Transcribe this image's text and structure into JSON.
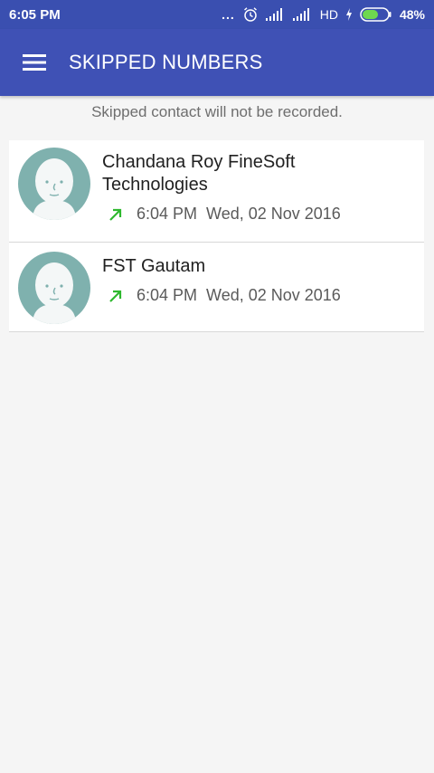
{
  "status_bar": {
    "time": "6:05 PM",
    "more": "...",
    "network": "HD",
    "battery": "48%"
  },
  "app_bar": {
    "title": "SKIPPED NUMBERS"
  },
  "hint": "Skipped contact will not be recorded.",
  "contacts": [
    {
      "name_line1": "Chandana Roy FineSoft",
      "name_line2": "Technologies",
      "time": "6:04 PM",
      "date": "Wed, 02 Nov 2016"
    },
    {
      "name_line1": "FST Gautam",
      "time": "6:04 PM",
      "date": "Wed, 02 Nov 2016"
    }
  ],
  "colors": {
    "primary": "#3f51b5",
    "status_bar": "#3a4fb0",
    "outgoing_arrow": "#2eb82e",
    "avatar_bg": "#7fb1ae",
    "battery": "#6ed84f"
  },
  "icons": {
    "menu": "hamburger-menu-icon",
    "call_direction": "outgoing-call-arrow-icon",
    "avatar": "default-contact-avatar"
  }
}
